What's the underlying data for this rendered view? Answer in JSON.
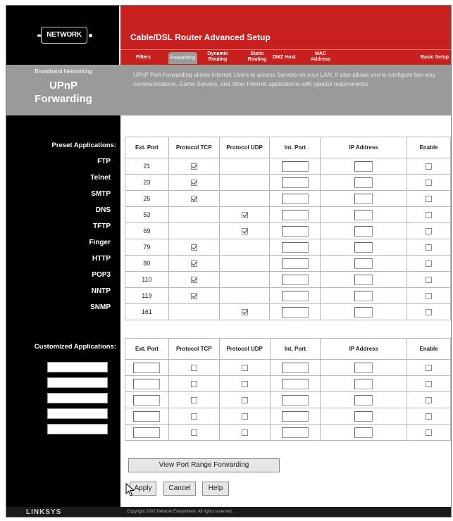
{
  "header": {
    "logo_text": "NETWORK",
    "title": "Cable/DSL Router Advanced Setup",
    "tabs": [
      {
        "label": "Filters"
      },
      {
        "label": "Forwarding"
      },
      {
        "label": "Dynamic Routing"
      },
      {
        "label": "Static Routing"
      },
      {
        "label": "DMZ Host"
      },
      {
        "label": "MAC Address"
      },
      {
        "label": "Basic Setup"
      }
    ]
  },
  "subheader": {
    "section": "Broadband Networking",
    "page_line1": "UPnP",
    "page_line2": "Forwarding",
    "description": "UPnP Port Forwarding allows Internet Users to access Servers on your LAN. It also allows you to configure two way communications, Game Servers, and other Internet applications with special requirements."
  },
  "preset": {
    "label": "Preset Applications:",
    "columns": [
      "Ext. Port",
      "Protocol TCP",
      "Protocol UDP",
      "Int. Port",
      "IP Address",
      "Enable"
    ],
    "rows": [
      {
        "name": "FTP",
        "ext_port": "21",
        "tcp": true,
        "udp": false,
        "enabled": false
      },
      {
        "name": "Telnet",
        "ext_port": "23",
        "tcp": true,
        "udp": false,
        "enabled": false
      },
      {
        "name": "SMTP",
        "ext_port": "25",
        "tcp": true,
        "udp": false,
        "enabled": false
      },
      {
        "name": "DNS",
        "ext_port": "53",
        "tcp": false,
        "udp": true,
        "enabled": false
      },
      {
        "name": "TFTP",
        "ext_port": "69",
        "tcp": false,
        "udp": true,
        "enabled": false
      },
      {
        "name": "Finger",
        "ext_port": "79",
        "tcp": true,
        "udp": false,
        "enabled": false
      },
      {
        "name": "HTTP",
        "ext_port": "80",
        "tcp": true,
        "udp": false,
        "enabled": false
      },
      {
        "name": "POP3",
        "ext_port": "110",
        "tcp": true,
        "udp": false,
        "enabled": false
      },
      {
        "name": "NNTP",
        "ext_port": "119",
        "tcp": true,
        "udp": false,
        "enabled": false
      },
      {
        "name": "SNMP",
        "ext_port": "161",
        "tcp": false,
        "udp": true,
        "enabled": false
      }
    ]
  },
  "custom": {
    "label": "Customized Applications:",
    "columns": [
      "Ext. Port",
      "Protocol TCP",
      "Protocol UDP",
      "Int. Port",
      "IP Address",
      "Enable"
    ],
    "row_count": 5
  },
  "buttons": {
    "view_range": "View Port Range Forwarding",
    "apply": "Apply",
    "cancel": "Cancel",
    "help": "Help"
  },
  "footer": {
    "brand": "LINKSYS",
    "copyright": "Copyright 2002 Network Everywhere. All rights reserved."
  }
}
